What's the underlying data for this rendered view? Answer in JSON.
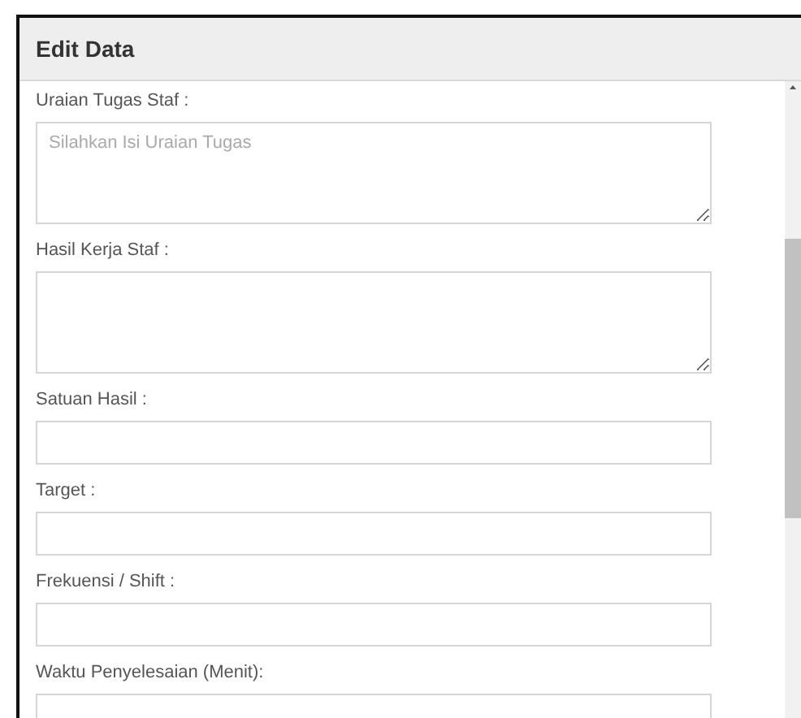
{
  "dialog": {
    "title": "Edit Data"
  },
  "fields": [
    {
      "kind": "textarea",
      "label": "Uraian Tugas Staf :",
      "placeholder": "Silahkan Isi Uraian Tugas"
    },
    {
      "kind": "textarea",
      "label": "Hasil Kerja Staf :"
    },
    {
      "kind": "input",
      "label": "Satuan Hasil :"
    },
    {
      "kind": "input",
      "label": "Target :"
    },
    {
      "kind": "input",
      "label": "Frekuensi / Shift :"
    },
    {
      "kind": "input",
      "label": "Waktu Penyelesaian (Menit):"
    }
  ]
}
